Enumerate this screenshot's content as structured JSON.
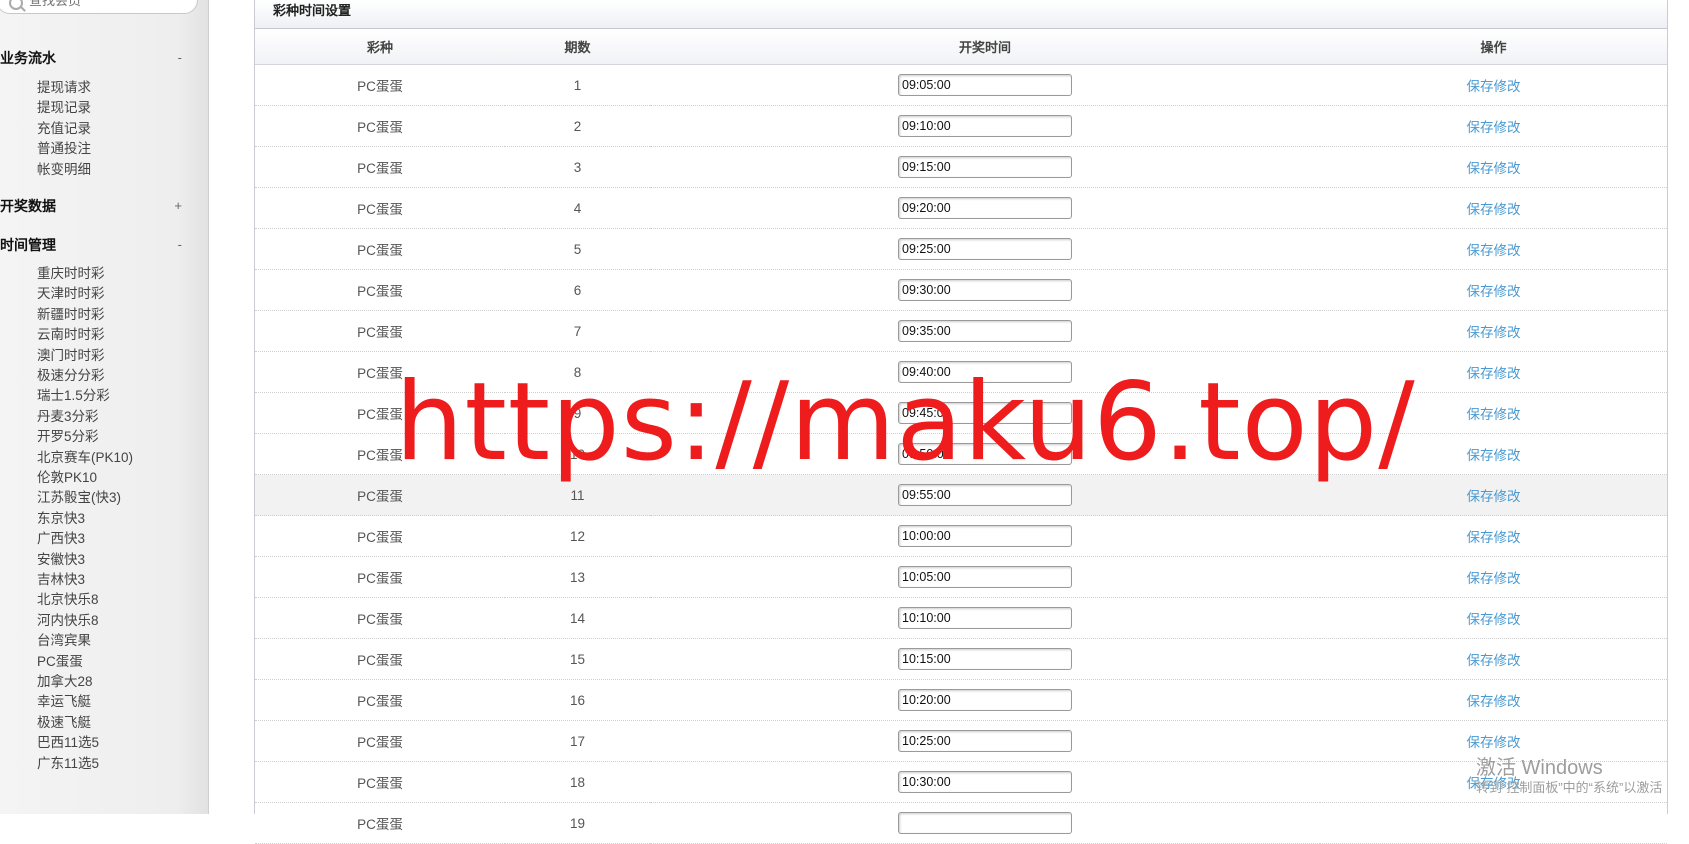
{
  "sidebar": {
    "search_placeholder": "查找会员",
    "groups": [
      {
        "title": "业务流水",
        "toggle": "-",
        "items": [
          "提现请求",
          "提现记录",
          "充值记录",
          "普通投注",
          "帐变明细"
        ]
      },
      {
        "title": "开奖数据",
        "toggle": "+",
        "items": []
      },
      {
        "title": "时间管理",
        "toggle": "-",
        "items": [
          "重庆时时彩",
          "天津时时彩",
          "新疆时时彩",
          "云南时时彩",
          "澳门时时彩",
          "极速分分彩",
          "瑞士1.5分彩",
          "丹麦3分彩",
          "开罗5分彩",
          "北京赛车(PK10)",
          "伦敦PK10",
          "江苏骰宝(快3)",
          "东京快3",
          "广西快3",
          "安徽快3",
          "吉林快3",
          "北京快乐8",
          "河内快乐8",
          "台湾宾果",
          "PC蛋蛋",
          "加拿大28",
          "幸运飞艇",
          "极速飞艇",
          "巴西11选5",
          "广东11选5"
        ]
      }
    ]
  },
  "panel": {
    "title": "彩种时间设置",
    "columns": [
      "彩种",
      "期数",
      "开奖时间",
      "操作"
    ],
    "rows": [
      {
        "lottery": "PC蛋蛋",
        "issue": "1",
        "time": "09:05:00",
        "action": "保存修改"
      },
      {
        "lottery": "PC蛋蛋",
        "issue": "2",
        "time": "09:10:00",
        "action": "保存修改"
      },
      {
        "lottery": "PC蛋蛋",
        "issue": "3",
        "time": "09:15:00",
        "action": "保存修改"
      },
      {
        "lottery": "PC蛋蛋",
        "issue": "4",
        "time": "09:20:00",
        "action": "保存修改"
      },
      {
        "lottery": "PC蛋蛋",
        "issue": "5",
        "time": "09:25:00",
        "action": "保存修改"
      },
      {
        "lottery": "PC蛋蛋",
        "issue": "6",
        "time": "09:30:00",
        "action": "保存修改"
      },
      {
        "lottery": "PC蛋蛋",
        "issue": "7",
        "time": "09:35:00",
        "action": "保存修改"
      },
      {
        "lottery": "PC蛋蛋",
        "issue": "8",
        "time": "09:40:00",
        "action": "保存修改"
      },
      {
        "lottery": "PC蛋蛋",
        "issue": "9",
        "time": "09:45:00",
        "action": "保存修改"
      },
      {
        "lottery": "PC蛋蛋",
        "issue": "10",
        "time": "09:50:00",
        "action": "保存修改"
      },
      {
        "lottery": "PC蛋蛋",
        "issue": "11",
        "time": "09:55:00",
        "action": "保存修改"
      },
      {
        "lottery": "PC蛋蛋",
        "issue": "12",
        "time": "10:00:00",
        "action": "保存修改"
      },
      {
        "lottery": "PC蛋蛋",
        "issue": "13",
        "time": "10:05:00",
        "action": "保存修改"
      },
      {
        "lottery": "PC蛋蛋",
        "issue": "14",
        "time": "10:10:00",
        "action": "保存修改"
      },
      {
        "lottery": "PC蛋蛋",
        "issue": "15",
        "time": "10:15:00",
        "action": "保存修改"
      },
      {
        "lottery": "PC蛋蛋",
        "issue": "16",
        "time": "10:20:00",
        "action": "保存修改"
      },
      {
        "lottery": "PC蛋蛋",
        "issue": "17",
        "time": "10:25:00",
        "action": "保存修改"
      },
      {
        "lottery": "PC蛋蛋",
        "issue": "18",
        "time": "10:30:00",
        "action": "保存修改"
      },
      {
        "lottery": "PC蛋蛋",
        "issue": "19",
        "time": "",
        "action": ""
      }
    ],
    "highlighted_row": 10
  },
  "overlay": {
    "watermark": "https://maku6.top/",
    "watermark_color": "#ee1c1c",
    "windows_activation_title": "激活 Windows",
    "windows_activation_hint": "转到“控制面板”中的“系统”以激活"
  },
  "colors": {
    "link": "#4a9ad2",
    "sidebar_bg": "#eeeeee"
  }
}
